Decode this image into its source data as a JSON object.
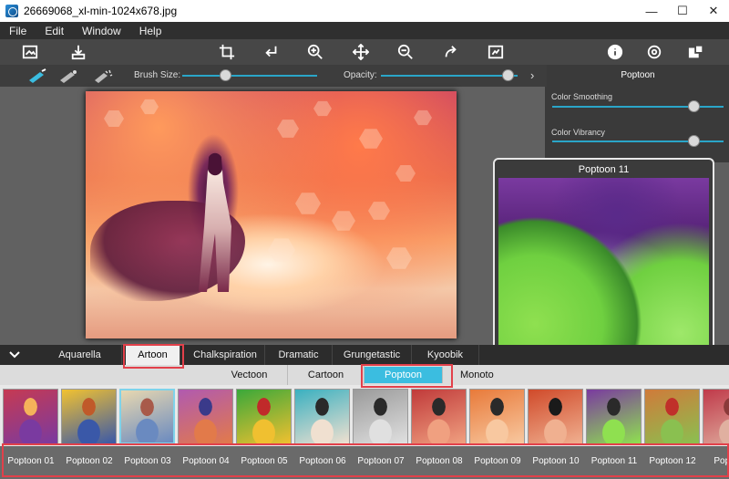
{
  "window": {
    "title": "26669068_xl-min-1024x678.jpg",
    "minimize": "—",
    "maximize": "☐",
    "close": "✕"
  },
  "menu": [
    "File",
    "Edit",
    "Window",
    "Help"
  ],
  "brush": {
    "size_label": "Brush Size:",
    "size_value": 0.3,
    "opacity_label": "Opacity:",
    "opacity_value": 0.97
  },
  "right_panel": {
    "title": "Poptoon",
    "sliders": [
      {
        "label": "Color Smoothing",
        "value": 0.85
      },
      {
        "label": "Color Vibrancy",
        "value": 0.85
      }
    ]
  },
  "preview": {
    "title": "Poptoon 11"
  },
  "categories": {
    "items": [
      "Aquarella",
      "Artoon",
      "Chalkspiration",
      "Dramatic",
      "Grungetastic",
      "Kyoobik"
    ],
    "active": "Artoon"
  },
  "subcategories": {
    "items": [
      "Vectoon",
      "Cartoon",
      "Poptoon",
      "Monoto"
    ],
    "active": "Poptoon"
  },
  "thumbnails": [
    {
      "label": "Poptoon 01",
      "colors": [
        "#c63a52",
        "#7a3aa0",
        "#f5b25a"
      ]
    },
    {
      "label": "Poptoon 02",
      "colors": [
        "#f2c230",
        "#3a58a8",
        "#c05a2a"
      ]
    },
    {
      "label": "Poptoon 03",
      "colors": [
        "#e8d8b0",
        "#6a8ac0",
        "#a85a4a"
      ]
    },
    {
      "label": "Poptoon 04",
      "colors": [
        "#b05ab0",
        "#e27a4a",
        "#3a3a8a"
      ]
    },
    {
      "label": "Poptoon 05",
      "colors": [
        "#3aa83a",
        "#f0c030",
        "#c02a2a"
      ]
    },
    {
      "label": "Poptoon 06",
      "colors": [
        "#3ab0c0",
        "#f0e0d0",
        "#2a2a2a"
      ]
    },
    {
      "label": "Poptoon 07",
      "colors": [
        "#9a9a9a",
        "#e0e0e0",
        "#2a2a2a"
      ]
    },
    {
      "label": "Poptoon 08",
      "colors": [
        "#c03a3a",
        "#f0a080",
        "#2a2a2a"
      ]
    },
    {
      "label": "Poptoon 09",
      "colors": [
        "#e87a3a",
        "#f8c8a0",
        "#2a2a2a"
      ]
    },
    {
      "label": "Poptoon 10",
      "colors": [
        "#d04a2a",
        "#f0b090",
        "#1a1a1a"
      ]
    },
    {
      "label": "Poptoon 11",
      "colors": [
        "#7a3aa0",
        "#8fe050",
        "#2a2a2a"
      ]
    },
    {
      "label": "Poptoon 12",
      "colors": [
        "#d07a3a",
        "#8ac050",
        "#c0302a"
      ]
    },
    {
      "label": "Poptoon",
      "colors": [
        "#c03a4a",
        "#e0b0a0",
        "#8a3a3a"
      ]
    }
  ],
  "highlight_color": "#e2404a",
  "accent_color": "#3bbde0"
}
